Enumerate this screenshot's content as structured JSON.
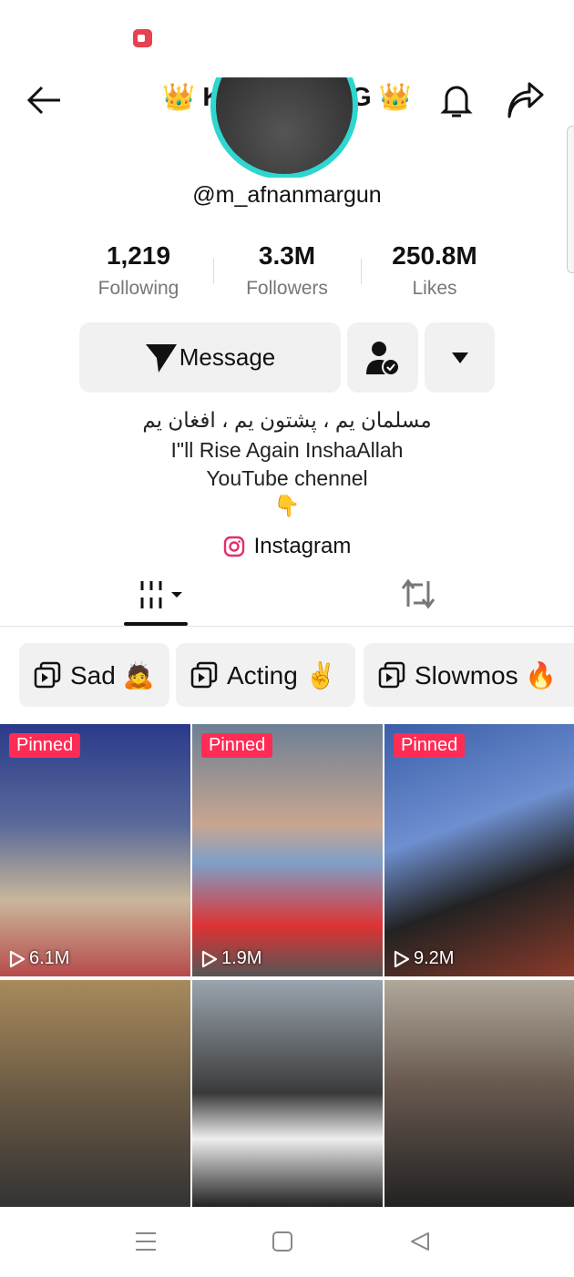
{
  "header": {
    "title": "👑 KARAK KING 👑"
  },
  "profile": {
    "handle": "@m_afnanmargun",
    "stats": [
      {
        "value": "1,219",
        "label": "Following"
      },
      {
        "value": "3.3M",
        "label": "Followers"
      },
      {
        "value": "250.8M",
        "label": "Likes"
      }
    ],
    "message_label": "Message",
    "bio": [
      "مسلمان یم ، پشتون یم ، افغان یم",
      "I\"ll Rise Again InshaAllah",
      "YouTube chennel",
      "👇"
    ],
    "link_label": "Instagram"
  },
  "playlists": [
    {
      "label": "Sad 🙇"
    },
    {
      "label": "Acting ✌️"
    },
    {
      "label": "Slowmos 🔥"
    }
  ],
  "videos": [
    {
      "pinned": "Pinned",
      "views": "6.1M"
    },
    {
      "pinned": "Pinned",
      "views": "1.9M"
    },
    {
      "pinned": "Pinned",
      "views": "9.2M"
    },
    {
      "pinned": "",
      "views": ""
    },
    {
      "pinned": "",
      "views": ""
    },
    {
      "pinned": "",
      "views": ""
    }
  ],
  "colors": {
    "accent": "#fe2c55",
    "ring": "#2fd6cf",
    "chip": "#f1f1f2"
  }
}
